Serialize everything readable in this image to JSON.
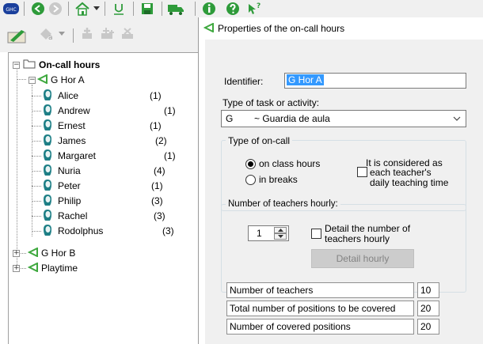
{
  "toolbar": {
    "icons": [
      "ghc-logo-icon",
      "back-icon",
      "forward-icon",
      "home-icon",
      "dropdown-icon",
      "underline-icon",
      "save-icon",
      "truck-icon",
      "info-icon",
      "help-icon",
      "whats-this-icon"
    ],
    "logo_text": "GHC"
  },
  "toolbar2": {
    "icons": [
      "properties-icon",
      "edit-label-icon",
      "add-icon",
      "add-multiple-icon",
      "delete-icon"
    ]
  },
  "tree": {
    "root_label": "On-call hours",
    "groups": [
      {
        "label": "G Hor A",
        "expander": "−",
        "teachers": [
          {
            "name": "Alice",
            "count": "(1)"
          },
          {
            "name": "Andrew",
            "count": "(1)"
          },
          {
            "name": "Ernest",
            "count": "(1)"
          },
          {
            "name": "James",
            "count": "(2)"
          },
          {
            "name": "Margaret",
            "count": "(1)"
          },
          {
            "name": "Nuria",
            "count": "(4)"
          },
          {
            "name": "Peter",
            "count": "(1)"
          },
          {
            "name": "Philip",
            "count": "(3)"
          },
          {
            "name": "Rachel",
            "count": "(3)"
          },
          {
            "name": "Rodolphus",
            "count": "(3)"
          }
        ]
      },
      {
        "label": "G Hor B",
        "expander": "+"
      },
      {
        "label": "Playtime",
        "expander": "+"
      }
    ],
    "root_expander": "−"
  },
  "properties": {
    "title": "Properties of the on-call hours",
    "identifier_label": "Identifier:",
    "identifier_value": "G Hor A",
    "task_label": "Type of task or activity:",
    "task_code": "G",
    "task_value": "~ Guardia de aula",
    "oncall_group_title": "Type of on-call",
    "radio_class_hours": "on class hours",
    "radio_breaks": "in breaks",
    "considered_line1": "It is considered as",
    "considered_line2": "each teacher's",
    "considered_line3": "daily teaching time",
    "teachers_group_title": "Number of teachers hourly:",
    "teachers_spinner_value": "1",
    "detail_line1": "Detail the number of",
    "detail_line2": "teachers hourly",
    "detail_button": "Detail hourly",
    "summary": [
      {
        "label": "Number of teachers",
        "value": "10"
      },
      {
        "label": "Total number of positions to be covered",
        "value": "20"
      },
      {
        "label": "Number of covered positions",
        "value": "20"
      }
    ]
  },
  "colors": {
    "selection": "#3399ff",
    "green_icon": "#2e9b3a",
    "teacher_icon": "#1e7f86",
    "group_arrow": "#3ea83e"
  }
}
